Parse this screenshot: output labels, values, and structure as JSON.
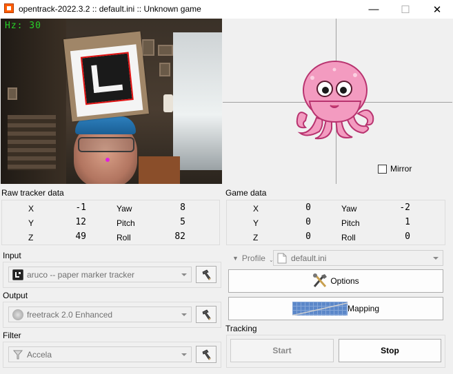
{
  "window": {
    "title": "opentrack-2022.3.2 :: default.ini :: Unknown game",
    "minimize_glyph": "—",
    "maximize_glyph": "☐",
    "close_glyph": "✕"
  },
  "camera": {
    "hz_label": "Hz: 30"
  },
  "preview": {
    "mirror_label": "Mirror",
    "mirror_checked": false
  },
  "raw_tracker": {
    "title": "Raw tracker data",
    "rows": [
      {
        "left_label": "X",
        "left_value": "-1",
        "right_label": "Yaw",
        "right_value": "8"
      },
      {
        "left_label": "Y",
        "left_value": "12",
        "right_label": "Pitch",
        "right_value": "5"
      },
      {
        "left_label": "Z",
        "left_value": "49",
        "right_label": "Roll",
        "right_value": "82"
      }
    ]
  },
  "game_data": {
    "title": "Game data",
    "rows": [
      {
        "left_label": "X",
        "left_value": "0",
        "right_label": "Yaw",
        "right_value": "-2"
      },
      {
        "left_label": "Y",
        "left_value": "0",
        "right_label": "Pitch",
        "right_value": "1"
      },
      {
        "left_label": "Z",
        "left_value": "0",
        "right_label": "Roll",
        "right_value": "0"
      }
    ]
  },
  "input": {
    "title": "Input",
    "value": "aruco -- paper marker tracker",
    "icon": "aruco-icon"
  },
  "output": {
    "title": "Output",
    "value": "freetrack 2.0 Enhanced",
    "icon": "freetrack-icon"
  },
  "filter": {
    "title": "Filter",
    "value": "Accela",
    "icon": "accela-icon"
  },
  "profile": {
    "label": "Profile",
    "value": "default.ini"
  },
  "buttons": {
    "options": "Options",
    "mapping": "Mapping",
    "start": "Start",
    "stop": "Stop"
  },
  "tracking": {
    "title": "Tracking"
  }
}
